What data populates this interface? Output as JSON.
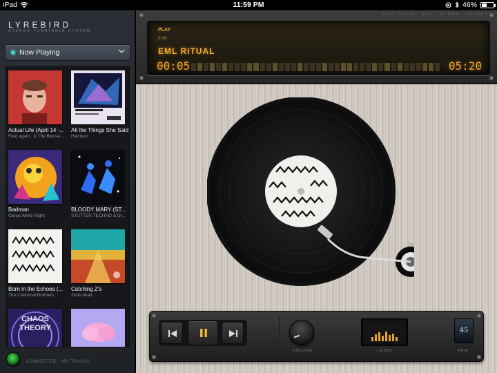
{
  "status_bar": {
    "device": "iPad",
    "time": "11:59 PM",
    "battery": "46%"
  },
  "sidebar": {
    "brand": "LYREBIRD",
    "brand_sub": "STEREO TURNTABLE SYSTEM",
    "now_playing_label": "Now Playing",
    "albums": [
      {
        "title": "Actual Life (April 14 -...",
        "artist": "Fred again.. & The Blesse..."
      },
      {
        "title": "All the Things She Said",
        "artist": "Harrison"
      },
      {
        "title": "Badman",
        "artist": "Ganja White Night"
      },
      {
        "title": "BLOODY MARY (ST...",
        "artist": "STUTTER TECHNO & Dr..."
      },
      {
        "title": "Born in the Echoes (...",
        "artist": "The Chemical Brothers"
      },
      {
        "title": "Catching Z's",
        "artist": "Zeds dead"
      },
      {
        "title": "",
        "artist": ""
      },
      {
        "title": "",
        "artist": ""
      }
    ],
    "connected_text": "CONNECTED · 350 TRACKS"
  },
  "header_text": "BELT DRIVE · 33⅓ · 45 RPM · STEREO",
  "display": {
    "state": "PLAY",
    "bitrate": "838k",
    "track": "EML RITUAL",
    "elapsed": "00:05",
    "remaining": "05:20"
  },
  "controls": {
    "volume_label": "VOLUME",
    "level_label": "LEVEL",
    "rpm_label": "RPM",
    "rpm_value": "45"
  },
  "colors": {
    "lcd_amber": "#f3a52a",
    "accent_teal": "#3fd6c6",
    "led_green": "#52e05a"
  }
}
